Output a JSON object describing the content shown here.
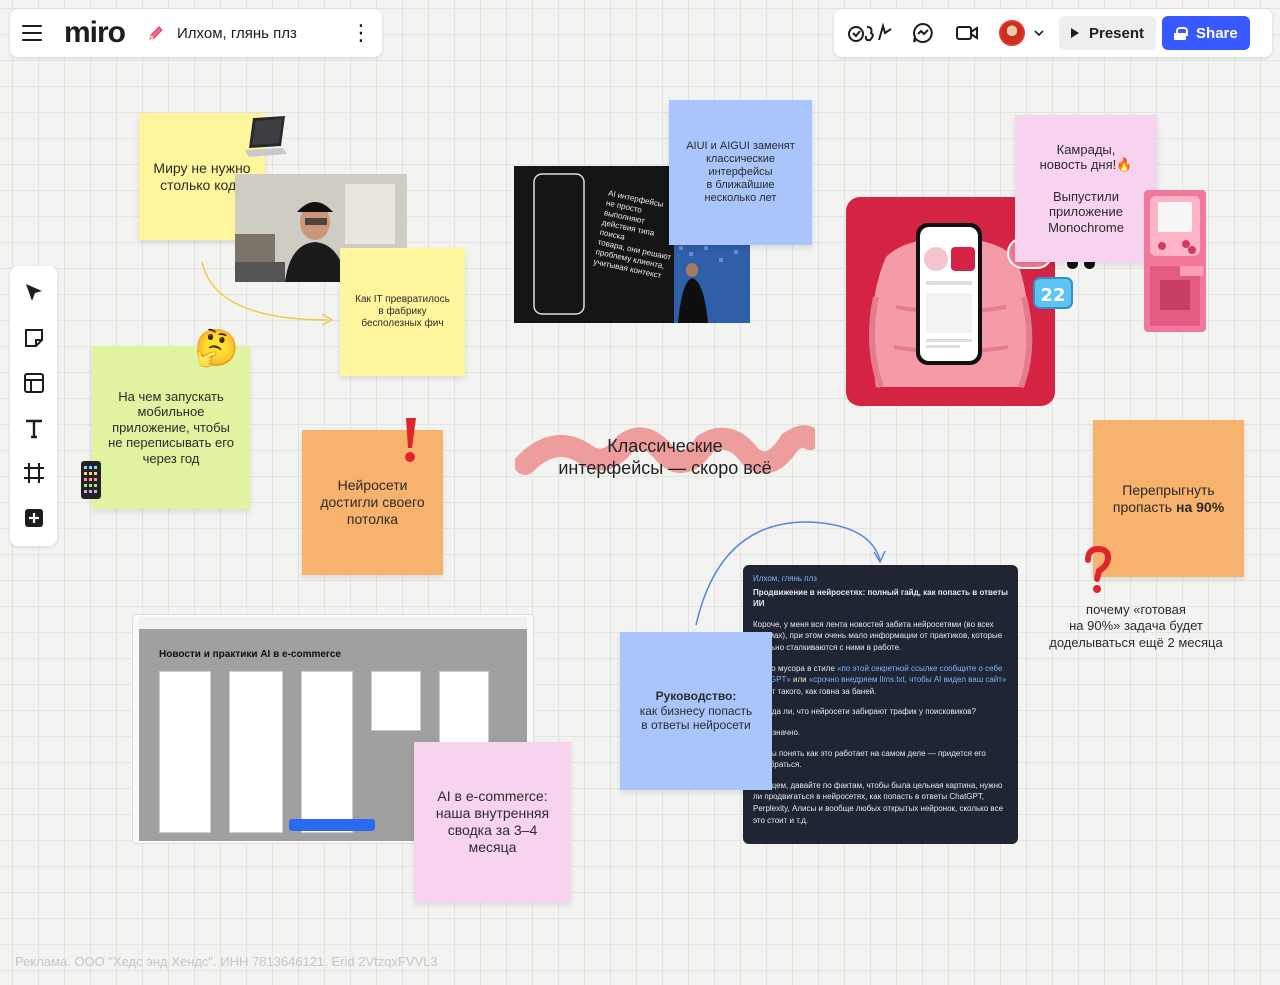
{
  "app": {
    "logo": "miro",
    "board_title": "Илхом, глянь плз",
    "kebab": "⋮"
  },
  "header_right": {
    "reactions_label": "reactions",
    "present_label": "Present",
    "share_label": "Share"
  },
  "colors": {
    "yellow": "#fff59d",
    "green": "#dff3a0",
    "orange": "#f7b26d",
    "blue": "#a9c5fb",
    "pink": "#f8d3ef",
    "accent": "#3859ff",
    "brush": "#eb8d8d",
    "dark_doc": "#1f2532",
    "red_card": "#d52443"
  },
  "stickies": {
    "code": "Миру не нужно\nстолько кода",
    "factory": "Как IT превратилось\nв фабрику\nбесполезных фич",
    "mobile": "На чем запускать\nмобильное\nприложение, чтобы\nне переписывать его\nчерез год",
    "neuro": "Нейросети\nдостигли своего\nпотолка",
    "aiui": "AIUI и AIGUI  заменят\nклассические\nинтерфейсы\nв ближайшие\nнесколько лет",
    "jump": "Перепрыгнуть\nпропасть",
    "jump_bold": "на 90%",
    "guide_bold": "Руководство:",
    "guide": "как бизнесу попасть\nв ответы нейросети",
    "ecom": "AI в e-commerce:\nнаша внутренняя\nсводка за 3–4\nмесяца",
    "monochrome": "Камрады,\nновость дня!🔥\n\nВыпустили\nприложение\nMonochrome"
  },
  "headline": "Классические\nинтерфейсы — скоро всё",
  "question_caption": "почему «готовая\nна 90%» задача будет\nдоделываться ещё 2 месяца",
  "presentation_text": "AI интерфейсы\nне просто выполняют\nдействия типа поиска\nтовара, они решают\nпроблему клиента,\nучитывая контекст",
  "ecommerce_board": {
    "title": "Новости и практики AI в e-commerce"
  },
  "dark_doc": {
    "header": "Илхом, глянь плз",
    "title": "Продвижение в нейросетях: полный гайд, как попасть в ответы ИИ",
    "p1": "Короче, у меня вся лента новостей забита нейросетями (во всех формах), при этом очень мало информации от практиков, которые реально сталкиваются с ними в работе.",
    "p2a": "Много мусора в стиле ",
    "p2b": "«по этой секретной ссылке сообщите о себе ChatGPT»",
    "p2c": " или ",
    "p2d": "«срочно внедряем llms.txt, чтобы AI видел ваш сайт»",
    "p2e": " — вот такого, как говна за баней.",
    "p3": "Правда ли, что нейросети забирают трафик у поисковиков?",
    "p4": "Однозначно.",
    "p5": "Чтобы понять как это работает на самом деле — придется его разобраться.",
    "p6": "В общем, давайте по фактам, чтобы была цельная картина, нужно ли продвигаться в нейросетях, как попасть в ответы ChatGPT, Perplexity, Алисы и вообще любых открытых нейронок, сколько все это стоит и т.д."
  },
  "footer": "Реклама. ООО \"Хедс энд Хендс\". ИНН 7813646121. Erid 2VtzqxFVVL3"
}
